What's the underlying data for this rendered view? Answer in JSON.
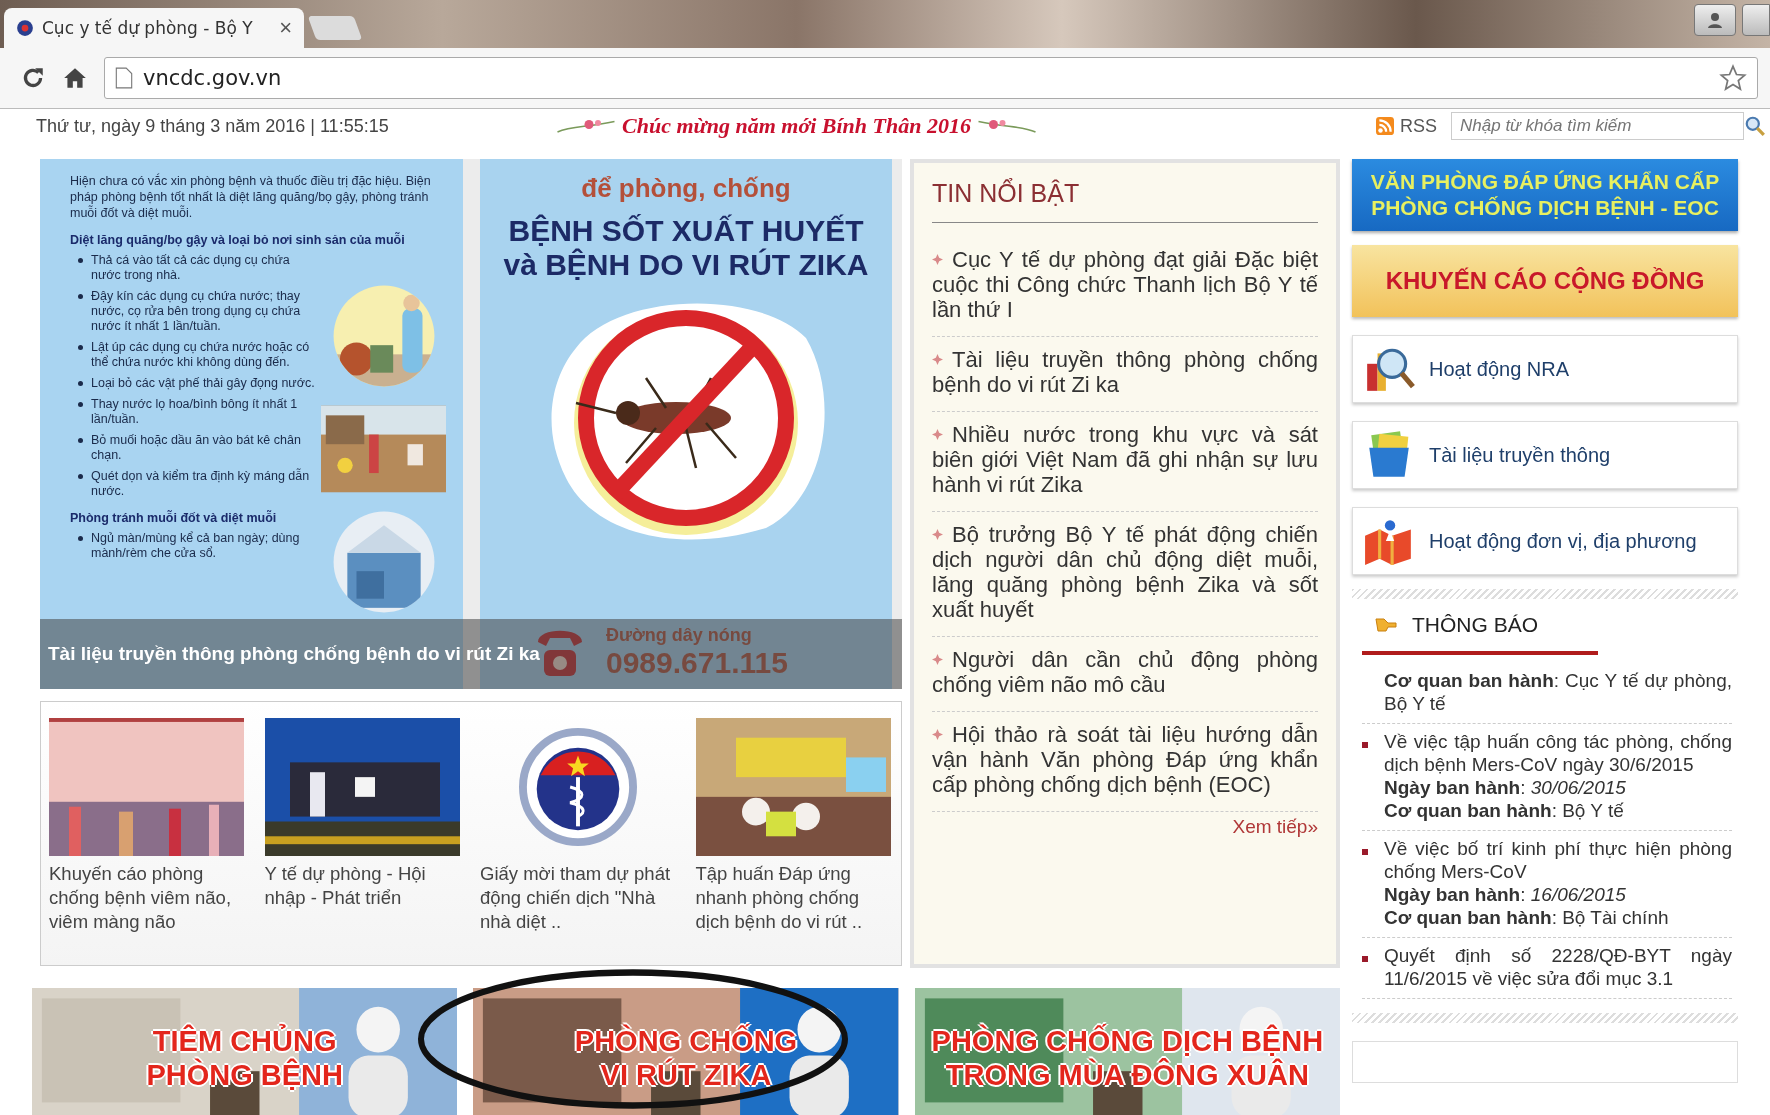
{
  "browser": {
    "tabs": [
      {
        "title": "Cục y tế dự phòng - Bộ Y",
        "selected": true,
        "close": "×"
      }
    ],
    "url": "vncdc.gov.vn"
  },
  "header": {
    "date": "Thứ tư, ngày 9 tháng 3 năm 2016 | 11:55:15",
    "greeting": "Chúc mừng năm mới Bính Thân 2016",
    "rss": "RSS",
    "search_placeholder": "Nhập từ khóa tìm kiếm"
  },
  "slideshow": {
    "left_panel": {
      "intro": "Hiện chưa có vắc xin phòng bệnh và thuốc điều trị đặc hiệu. Biện pháp phòng bệnh tốt nhất là diệt lăng quăng/bọ gậy, phòng tránh muỗi đốt và diệt muỗi.",
      "sections": [
        {
          "heading": "Diệt lăng quăng/bọ gậy và loại bỏ nơi sinh sản của muỗi",
          "bullets": [
            "Thả cá vào tất cả các dụng cụ chứa nước trong nhà.",
            "Đậy kín các dụng cụ chứa nước; thay nước, cọ rửa bên trong dụng cụ chứa nước ít nhất 1 lần/tuần.",
            "Lật úp các dụng cụ chứa nước hoặc có thể chứa nước khi không dùng đến.",
            "Loại bỏ các vật phế thải gây đọng nước.",
            "Thay nước lọ hoa/bình bông ít nhất 1 lần/tuần.",
            "Bỏ muối hoặc dầu ăn vào bát kê chân chạn.",
            "Quét dọn và kiểm tra định kỳ máng dẫn nước."
          ]
        },
        {
          "heading": "Phòng tránh muỗi đốt và diệt muỗi",
          "bullets": [
            "Ngủ màn/mùng kể cả ban ngày; dùng mành/rèm che cửa sổ."
          ]
        }
      ]
    },
    "right_panel": {
      "subtitle": "để phòng, chống",
      "title_lines": [
        "BỆNH SỐT XUẤT HUYẾT",
        "và BỆNH DO VI RÚT ZIKA"
      ],
      "hotline_label": "Đường dây nóng",
      "hotline": "0989.671.115"
    },
    "caption": "Tài liệu truyền thông phòng chống bệnh do vi rút Zi ka"
  },
  "thumbnails": [
    {
      "kind": "picture",
      "caption": "Khuyến cáo phòng chống bệnh viêm não, viêm màng não"
    },
    {
      "kind": "picture",
      "caption": "Y tế dự phòng - Hội nhập - Phát triển"
    },
    {
      "kind": "emblem",
      "caption": "Giấy mời tham dự phát động chiến dịch \"Nhà nhà diệt .."
    },
    {
      "kind": "picture",
      "caption": "Tập huấn Đáp ứng nhanh phòng chống dịch bệnh do vi rút .."
    }
  ],
  "news": {
    "title": "TIN NỔI BẬT",
    "items": [
      "Cục Y tế dự phòng đạt giải Đặc biệt cuộc thi Công chức Thanh lịch Bộ Y tế lần thứ I",
      "Tài liệu truyền thông phòng chống bệnh do vi rút Zi ka",
      "Nhiều nước trong khu vực và sát biên giới Việt Nam đã ghi nhận sự lưu hành vi rút Zika",
      "Bộ trưởng Bộ Y tế phát động chiến dịch người dân chủ động diệt muỗi, lăng quăng phòng bệnh Zika và sốt xuất huyết",
      "Người dân cần chủ động phòng chống viêm não mô cầu",
      "Hội thảo rà soát tài liệu hướng dẫn vận hành Văn phòng Đáp ứng khẩn cấp phòng chống dịch bệnh (EOC)"
    ],
    "more": "Xem tiếp»"
  },
  "sidebar": {
    "eoc_banner": [
      "VĂN PHÒNG ĐÁP ỨNG KHẨN CẤP",
      "PHÒNG CHỐNG DỊCH BỆNH - EOC"
    ],
    "advice_banner": "KHUYẾN CÁO CỘNG ĐỒNG",
    "links": [
      {
        "kind": "search",
        "label": "Hoạt động NRA"
      },
      {
        "kind": "folder",
        "label": "Tài liệu truyền thông"
      },
      {
        "kind": "map",
        "label": "Hoạt động đơn vị, địa phương"
      }
    ],
    "notices": {
      "title": "THÔNG BÁO",
      "items": [
        {
          "bullet": false,
          "lines": [
            "**Cơ quan ban hành**: Cục Y tế dự phòng, Bộ Y tế"
          ]
        },
        {
          "bullet": true,
          "lines": [
            "Về việc tập huấn công tác phòng, chống dịch bệnh Mers-CoV ngày 30/6/2015",
            "**Ngày ban hành**: *30/06/2015*",
            "**Cơ quan ban hành**: Bộ Y tế"
          ]
        },
        {
          "bullet": true,
          "lines": [
            "Về việc bố trí kinh phí thực hiện phòng chống Mers-CoV",
            "**Ngày ban hành**: *16/06/2015*",
            "**Cơ quan ban hành**: Bộ Tài chính"
          ]
        },
        {
          "bullet": true,
          "lines": [
            "Quyết định số 2228/QĐ-BYT ngày 11/6/2015 về việc sửa đổi mục 3.1"
          ]
        }
      ]
    }
  },
  "banners": [
    {
      "lines": [
        "TIÊM CHỦNG",
        "PHÒNG BỆNH"
      ],
      "circled": false
    },
    {
      "lines": [
        "PHÒNG CHỐNG",
        "VI RÚT ZIKA"
      ],
      "circled": true
    },
    {
      "lines": [
        "PHÒNG CHỐNG DỊCH BỆNH",
        "TRONG MÙA ĐÔNG XUÂN"
      ],
      "circled": false
    }
  ]
}
